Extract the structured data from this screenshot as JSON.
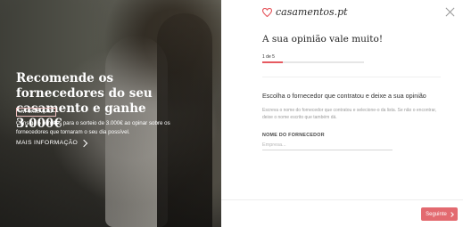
{
  "hero": {
    "title": "Recomende os fornecedores do seu casamento e ganhe 3.000€",
    "badge": "INFORMAÇÃO",
    "text": "Consiga 5 bilhetes para o sorteio de 3.000€ ao opinar sobre os fornecedores que tornaram o seu dia possível.",
    "link": "MAIS INFORMAÇÃO"
  },
  "brand": {
    "name": "casamentos.pt",
    "accent": "#e65a60"
  },
  "form": {
    "heading": "A sua opinião vale muito!",
    "step": "1 de 5",
    "progress_fraction": 0.2,
    "question": "Escolha o fornecedor que contratou e deixe a sua opinião",
    "help": "Escreva o nome do fornecedor que contratou e selecione-o da lista. Se não o encontrar, deixe o nome escrito que também dá.",
    "field_label": "NOME DO FORNECEDOR",
    "field_placeholder": "Empresa...",
    "field_value": ""
  },
  "footer": {
    "next_label": "Seguinte"
  },
  "icons": {
    "logo": "heart-logo-icon",
    "close": "close-icon",
    "link_arrow": "chevron-right-icon",
    "next_arrow": "chevron-right-icon"
  }
}
